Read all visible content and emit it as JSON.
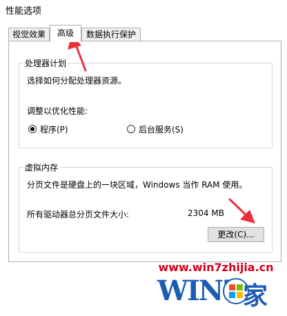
{
  "window": {
    "title": "性能选项"
  },
  "tabs": [
    {
      "label": "视觉效果",
      "active": false
    },
    {
      "label": "高级",
      "active": true
    },
    {
      "label": "数据执行保护",
      "active": false
    }
  ],
  "processor_group": {
    "title": "处理器计划",
    "description": "选择如何分配处理器资源。",
    "adjust_label": "调整以优化性能:",
    "options": [
      {
        "label": "程序(P)",
        "selected": true
      },
      {
        "label": "后台服务(S)",
        "selected": false
      }
    ]
  },
  "virtual_memory_group": {
    "title": "虚拟内存",
    "description": "分页文件是硬盘上的一块区域，Windows 当作 RAM 使用。",
    "total_label": "所有驱动器总分页文件大小:",
    "total_value": "2304 MB",
    "change_button": "更改(C)..."
  },
  "watermark": {
    "url": "www.win7zhijia.cn",
    "logo_text": "WIN7",
    "logo_suffix": "家"
  },
  "colors": {
    "arrow": "#e8303a",
    "watermark_url": "#d4001b",
    "watermark_logo": "#1b5db4"
  }
}
